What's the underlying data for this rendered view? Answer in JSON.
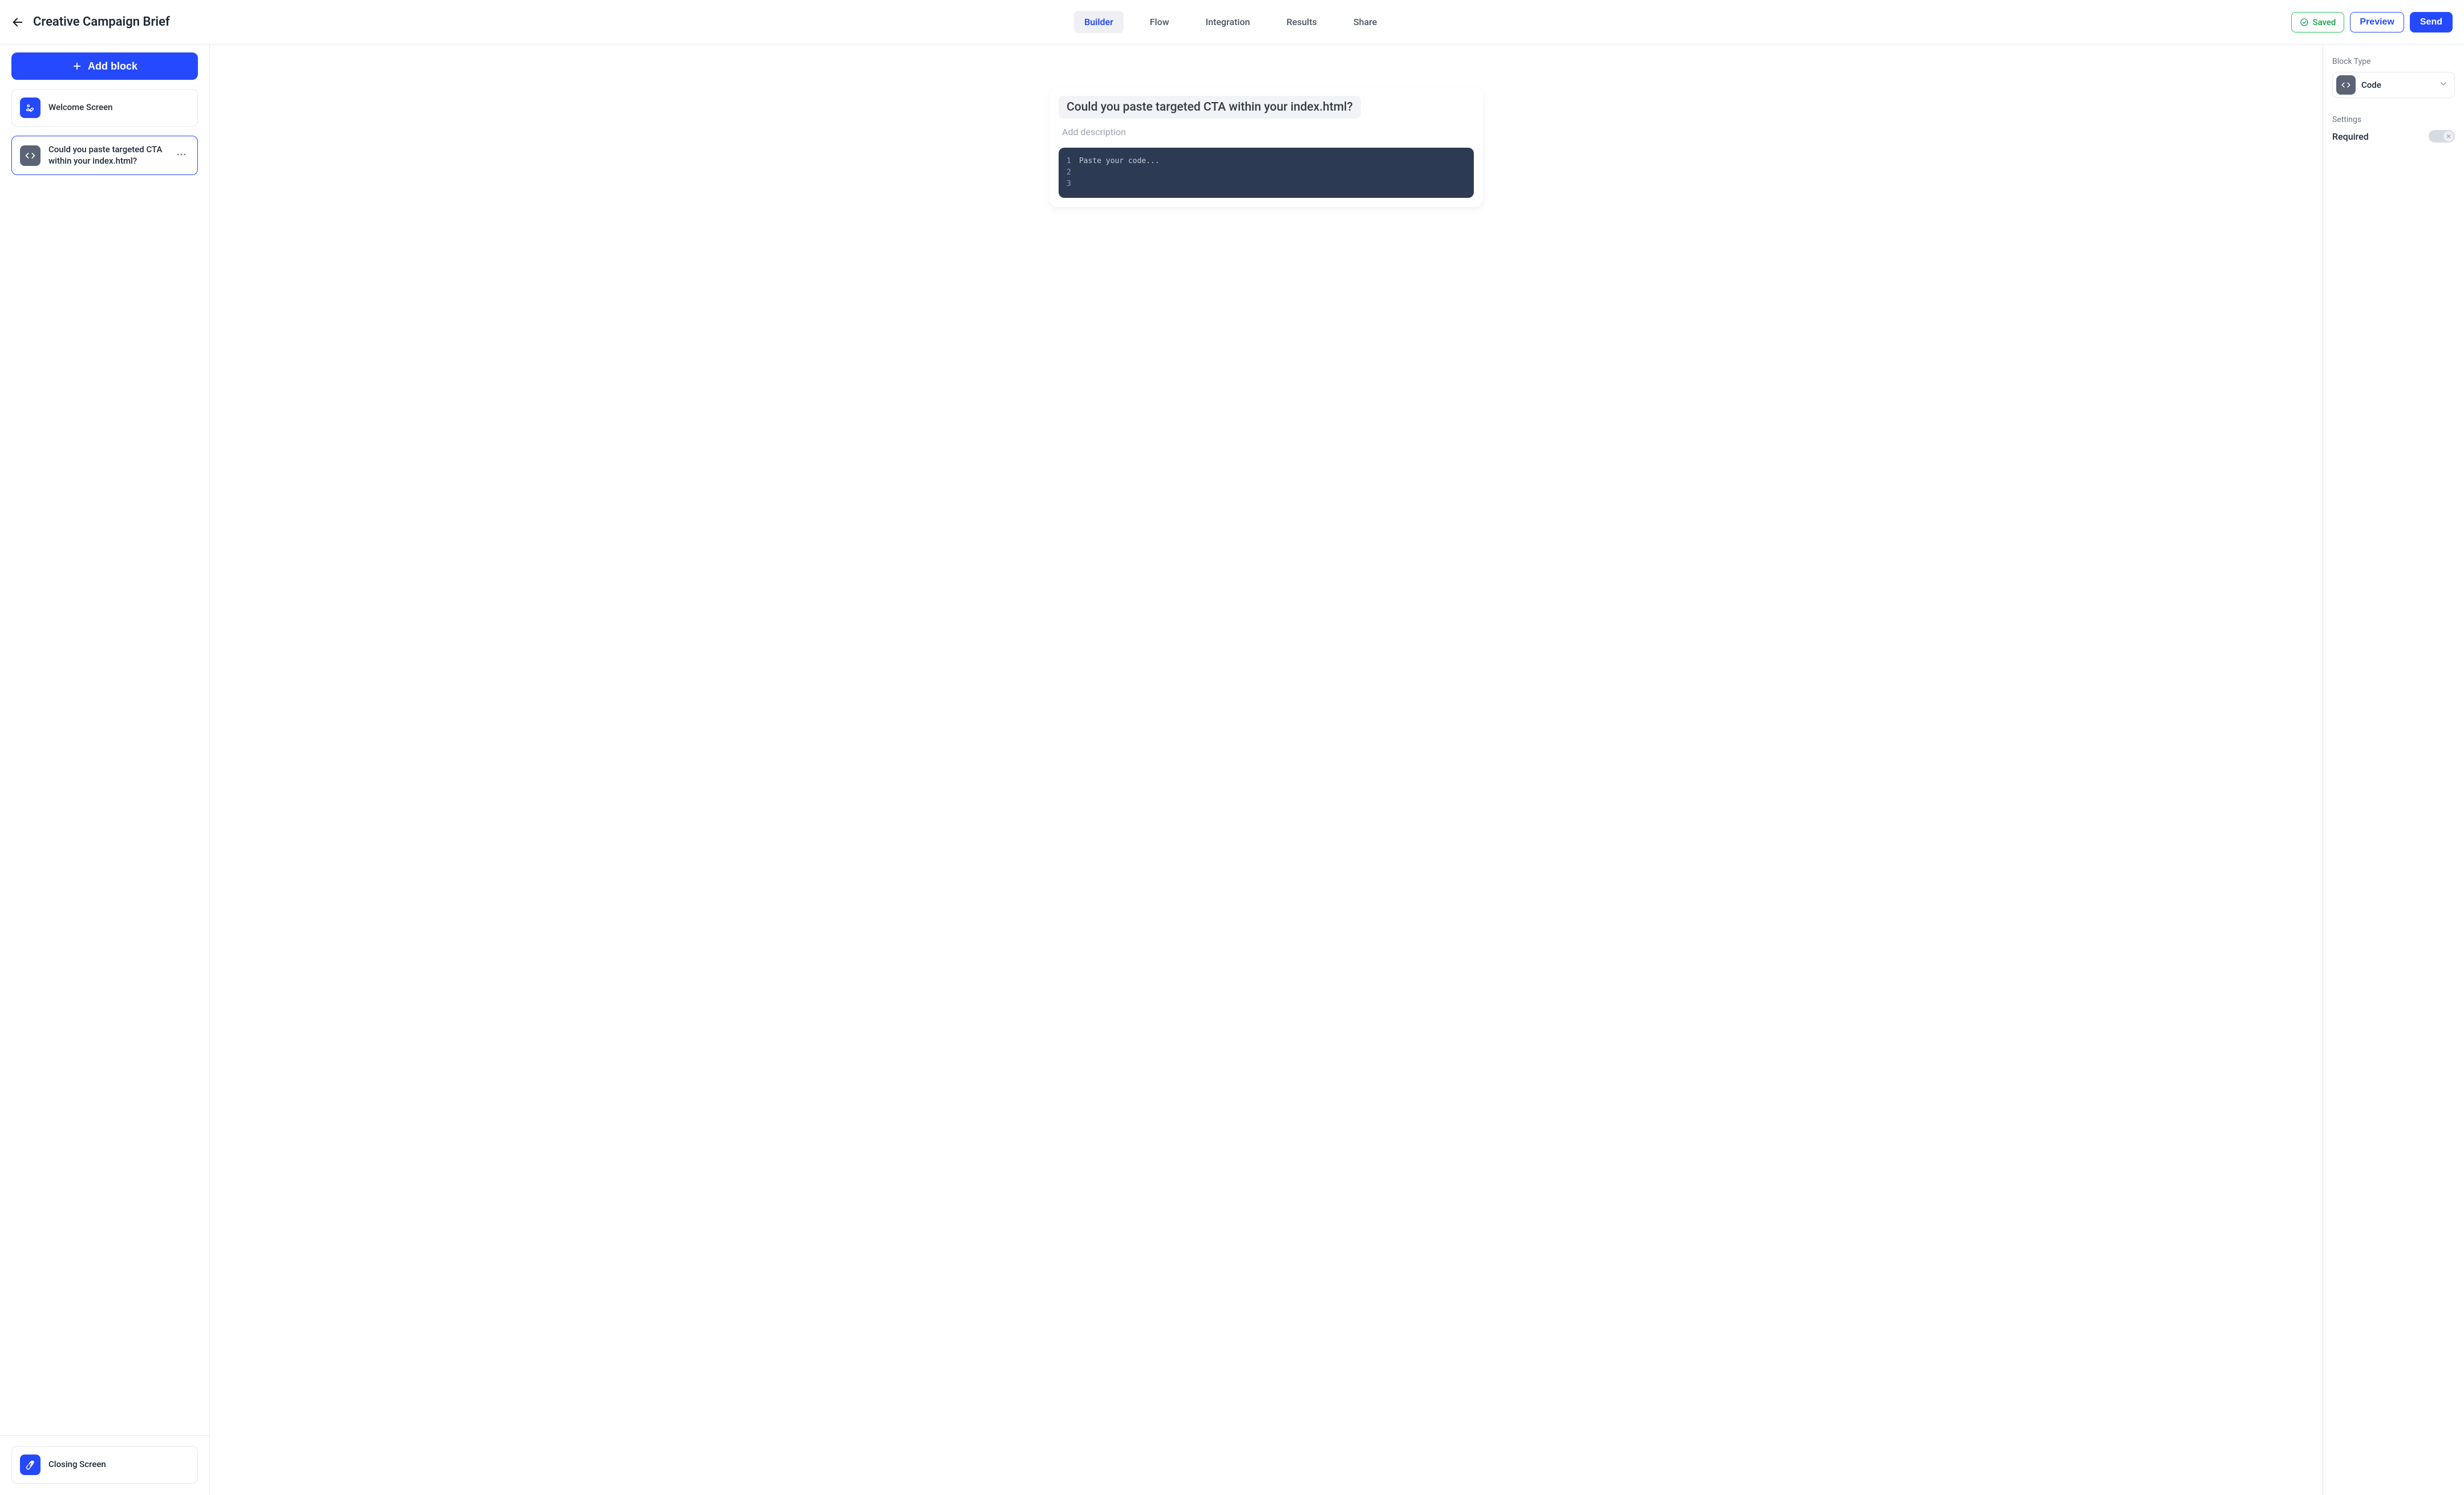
{
  "header": {
    "title": "Creative Campaign Brief",
    "tabs": [
      "Builder",
      "Flow",
      "Integration",
      "Results",
      "Share"
    ],
    "active_tab_index": 0,
    "saved_label": "Saved",
    "preview_label": "Preview",
    "send_label": "Send"
  },
  "sidebar": {
    "add_block_label": "Add block",
    "blocks": [
      {
        "label": "Welcome Screen",
        "icon": "welcome",
        "selected": false
      },
      {
        "label": "Could you paste targeted CTA within your index.html?",
        "icon": "code",
        "selected": true
      }
    ],
    "closing_block": {
      "label": "Closing Screen",
      "icon": "wave"
    }
  },
  "canvas": {
    "question_title": "Could you paste targeted CTA within your index.html?",
    "description_placeholder": "Add description",
    "code_placeholder": "Paste your code...",
    "code_line_numbers": [
      "1",
      "2",
      "3"
    ]
  },
  "right_panel": {
    "block_type_label": "Block Type",
    "block_type_value": "Code",
    "settings_label": "Settings",
    "required_label": "Required",
    "required_on": false
  }
}
